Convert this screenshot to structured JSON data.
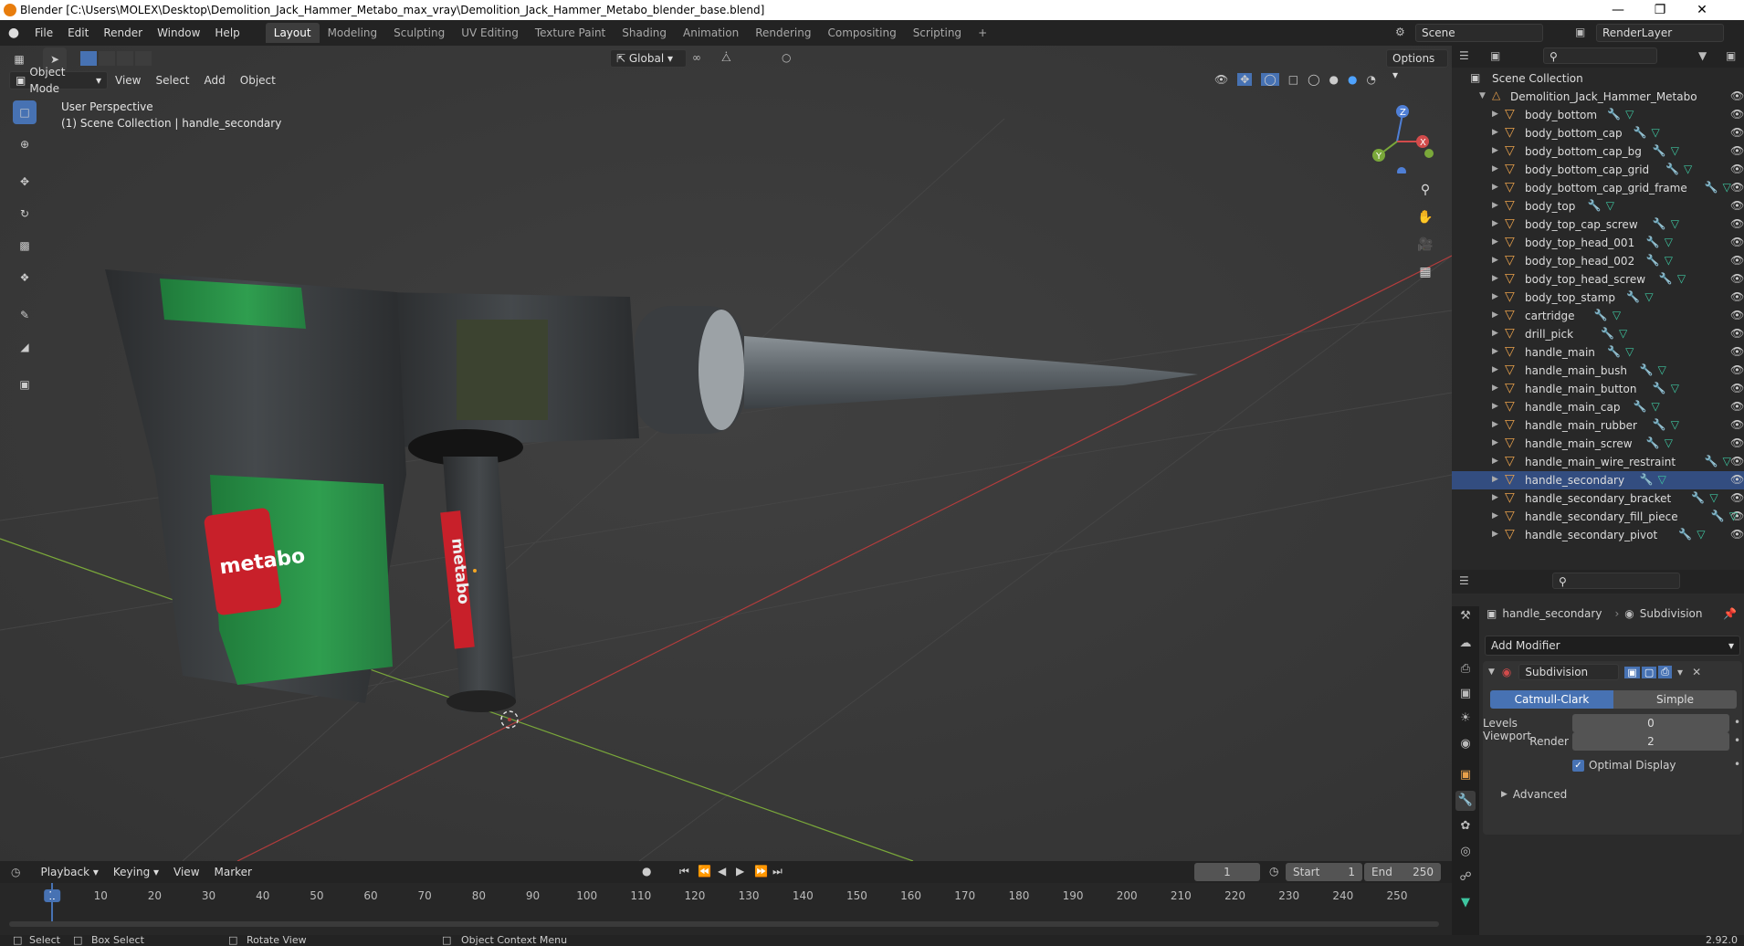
{
  "window": {
    "title": "Blender [C:\\Users\\MOLEX\\Desktop\\Demolition_Jack_Hammer_Metabo_max_vray\\Demolition_Jack_Hammer_Metabo_blender_base.blend]",
    "minimize": "—",
    "maximize": "❐",
    "close": "✕"
  },
  "menubar": {
    "items": [
      "File",
      "Edit",
      "Render",
      "Window",
      "Help"
    ]
  },
  "workspaces": [
    "Layout",
    "Modeling",
    "Sculpting",
    "UV Editing",
    "Texture Paint",
    "Shading",
    "Animation",
    "Rendering",
    "Compositing",
    "Scripting"
  ],
  "workspace_add": "+",
  "scene": {
    "label": "Scene",
    "renderlayer": "RenderLayer"
  },
  "viewport_header": {
    "mode": "Object Mode",
    "menus": [
      "View",
      "Select",
      "Add",
      "Object"
    ],
    "orientation": "Global",
    "options": "Options"
  },
  "viewport": {
    "perspective": "User Perspective",
    "collection_info": "(1) Scene Collection | handle_secondary",
    "brand_text_body": "metabo",
    "brand_text_handle": "metabo",
    "gizmo_labels": {
      "z": "Z",
      "y": "Y",
      "x": "X"
    }
  },
  "outliner": {
    "root": "Scene Collection",
    "collection": "Demolition_Jack_Hammer_Metabo",
    "objects": [
      "body_bottom",
      "body_bottom_cap",
      "body_bottom_cap_bg",
      "body_bottom_cap_grid",
      "body_bottom_cap_grid_frame",
      "body_top",
      "body_top_cap_screw",
      "body_top_head_001",
      "body_top_head_002",
      "body_top_head_screw",
      "body_top_stamp",
      "cartridge",
      "drill_pick",
      "handle_main",
      "handle_main_bush",
      "handle_main_button",
      "handle_main_cap",
      "handle_main_rubber",
      "handle_main_screw",
      "handle_main_wire_restraint",
      "handle_secondary",
      "handle_secondary_bracket",
      "handle_secondary_fill_piece",
      "handle_secondary_pivot"
    ],
    "selected": "handle_secondary"
  },
  "properties": {
    "object_name": "handle_secondary",
    "modifier_crumb": "Subdivision",
    "add_modifier": "Add Modifier",
    "modifier": {
      "name": "Subdivision",
      "type_options": [
        "Catmull-Clark",
        "Simple"
      ],
      "selected_type": "Catmull-Clark",
      "levels_viewport_label": "Levels Viewport",
      "levels_viewport": "0",
      "render_label": "Render",
      "render": "2",
      "optimal_display_label": "Optimal Display",
      "optimal_display": true,
      "advanced": "Advanced"
    }
  },
  "timeline": {
    "menus": [
      "Playback",
      "Keying",
      "View",
      "Marker"
    ],
    "current_frame": "1",
    "start_label": "Start",
    "start": "1",
    "end_label": "End",
    "end": "250",
    "ruler": [
      "1",
      "10",
      "20",
      "30",
      "40",
      "50",
      "60",
      "70",
      "80",
      "90",
      "100",
      "110",
      "120",
      "130",
      "140",
      "150",
      "160",
      "170",
      "180",
      "190",
      "200",
      "210",
      "220",
      "230",
      "240",
      "250"
    ]
  },
  "statusbar": {
    "select": "Select",
    "box_select": "Box Select",
    "rotate_view": "Rotate View",
    "context_menu": "Object Context Menu",
    "version": "2.92.0"
  },
  "colors": {
    "accent": "#4772b3",
    "viewport_bg": "#3a3a3a",
    "panel_bg": "#282828",
    "selected_row": "#334d80",
    "mesh_icon": "#e8a04b",
    "x_axis": "#b43c3c",
    "y_axis": "#7aa83a",
    "metabo_green": "#2f9e4f",
    "metabo_red": "#c8202a"
  }
}
